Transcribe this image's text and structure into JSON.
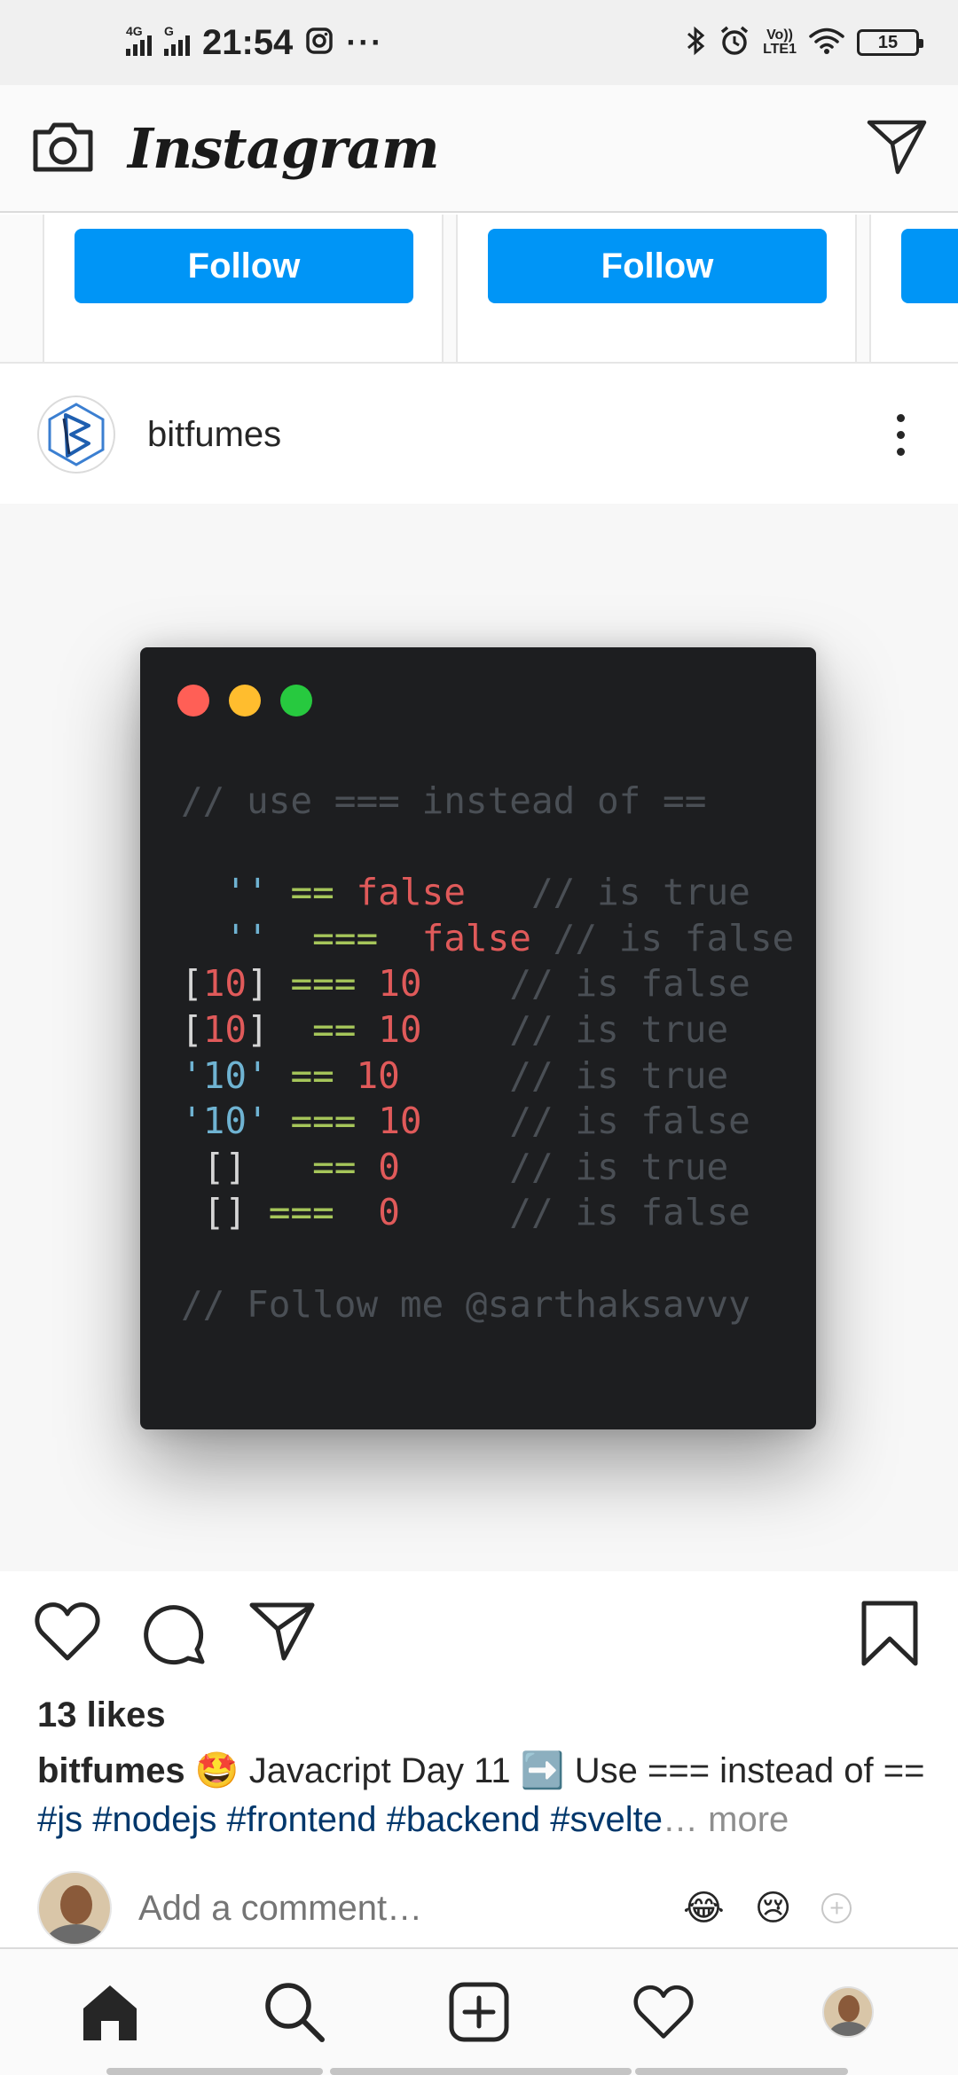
{
  "status_bar": {
    "time": "21:54",
    "signal1_label": "4G",
    "signal2_label": "G",
    "overflow": "···",
    "volte_top": "Vo))",
    "volte_bottom": "LTE1",
    "battery": "15",
    "icons": [
      "instagram-notification-icon",
      "bluetooth-icon",
      "alarm-icon",
      "wifi-icon"
    ]
  },
  "header": {
    "brand": "Instagram",
    "left_icon": "camera-icon",
    "right_icon": "direct-message-icon"
  },
  "suggestions": {
    "cards": [
      {
        "follow_label": "Follow"
      },
      {
        "follow_label": "Follow"
      },
      {
        "follow_label": ""
      }
    ]
  },
  "post": {
    "username": "bitfumes",
    "code_lines": [
      "// use === instead of ==",
      "",
      "  '' == false   // is true",
      "  ''  ===  false // is false",
      "[10] === 10    // is false",
      "[10]  == 10    // is true",
      "'10' == 10     // is true",
      "'10' === 10    // is false",
      " []   == 0     // is true",
      " [] ===  0     // is false",
      "",
      "// Follow me @sarthaksavvy"
    ],
    "colors": {
      "window": "#1d1e20",
      "dot_red": "#ff5f56",
      "dot_yellow": "#ffbd2e",
      "dot_green": "#27c93f",
      "accent_blue": "#0095f6"
    },
    "likes": "13 likes",
    "caption": {
      "user": "bitfumes",
      "emoji1": "🤩",
      "text1": " Javacript Day 11 ",
      "emoji2": "➡️",
      "text2": " Use === instead of == ",
      "tags": [
        "#js",
        "#nodejs",
        "#frontend",
        "#backend",
        "#svelte"
      ],
      "ellipsis": "…",
      "more": " more"
    },
    "comment": {
      "placeholder": "Add a comment…",
      "quick_emojis": [
        "😂",
        "😢"
      ],
      "add_symbol": "+"
    }
  },
  "bottom_nav": {
    "items": [
      "home-icon",
      "search-icon",
      "new-post-icon",
      "activity-heart-icon",
      "profile-avatar"
    ]
  }
}
